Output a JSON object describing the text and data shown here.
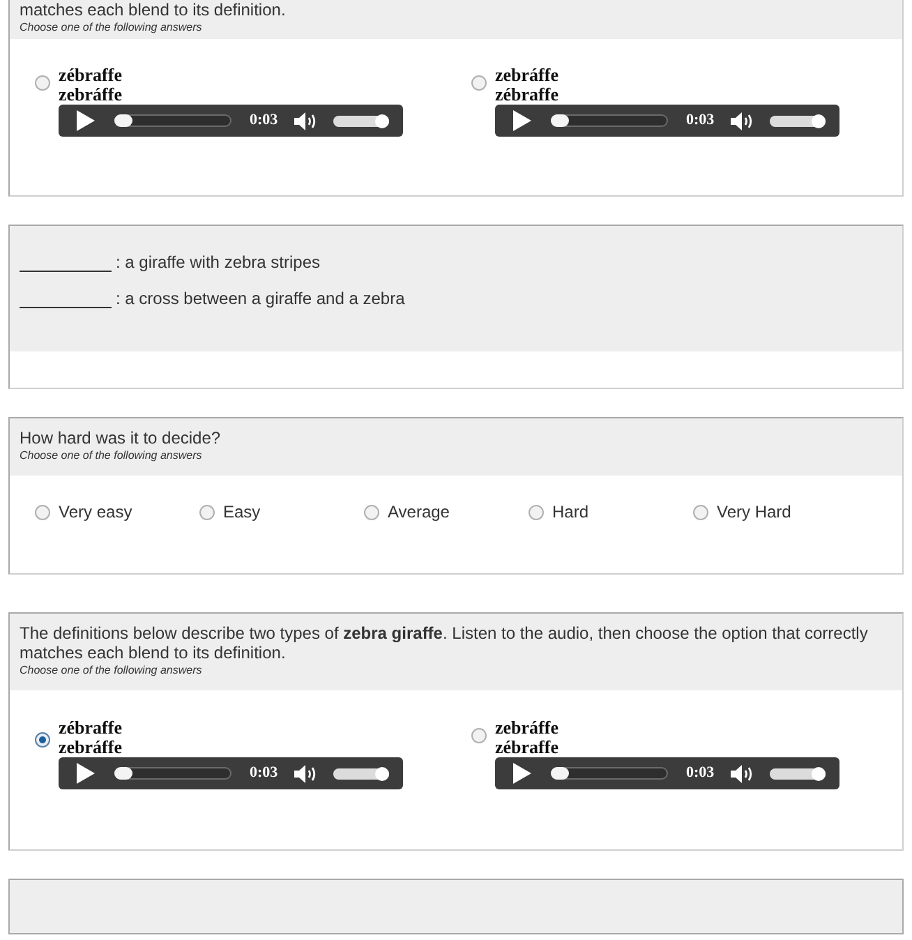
{
  "questions": [
    {
      "kind": "audio_choice",
      "prompt": "matches each blend to its definition.",
      "instruction": "Choose one of the following answers",
      "options": [
        {
          "selected": false,
          "lines": [
            "zébraffe",
            "zebráffe"
          ],
          "audio": {
            "time": "0:03",
            "seek": {
              "level": 0
            },
            "volume": {
              "level": 1
            }
          }
        },
        {
          "selected": false,
          "lines": [
            "zebráffe",
            "zébraffe"
          ],
          "audio": {
            "time": "0:03",
            "seek": {
              "level": 0
            },
            "volume": {
              "level": 1
            }
          }
        }
      ]
    },
    {
      "kind": "definitions",
      "items": [
        {
          "text": ": a giraffe with zebra stripes"
        },
        {
          "text": ": a cross between a giraffe and a zebra"
        }
      ]
    },
    {
      "kind": "rating",
      "prompt": "How hard was it to decide?",
      "instruction": "Choose one of the following answers",
      "options": [
        {
          "label": "Very easy",
          "selected": false
        },
        {
          "label": "Easy",
          "selected": false
        },
        {
          "label": "Average",
          "selected": false
        },
        {
          "label": "Hard",
          "selected": false
        },
        {
          "label": "Very Hard",
          "selected": false
        }
      ]
    },
    {
      "kind": "audio_choice",
      "prompt": "The definitions below describe two types of **zebra giraffe**. Listen to the audio, then choose the option that correctly matches each blend to its definition.",
      "instruction": "Choose one of the following answers",
      "options": [
        {
          "selected": true,
          "lines": [
            "zébraffe",
            "zebráffe"
          ],
          "audio": {
            "time": "0:03",
            "seek": {
              "level": 0
            },
            "volume": {
              "level": 1
            }
          }
        },
        {
          "selected": false,
          "lines": [
            "zebráffe",
            "zébraffe"
          ],
          "audio": {
            "time": "0:03",
            "seek": {
              "level": 0
            },
            "volume": {
              "level": 1
            }
          }
        }
      ]
    }
  ]
}
